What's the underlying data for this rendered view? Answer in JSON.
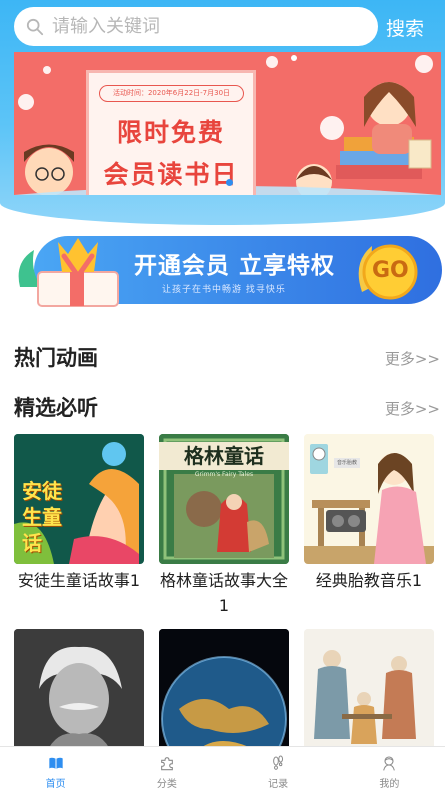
{
  "search": {
    "placeholder": "请输入关键词",
    "button_label": "搜索"
  },
  "banner": {
    "date_text": "活动时间：2020年6月22日-7月30日",
    "headline_line1": "限时免费",
    "headline_line2": "会员读书日"
  },
  "vip": {
    "title": "开通会员  立享特权",
    "subtitle": "让孩子在书中畅游  找寻快乐",
    "go_label": "GO"
  },
  "sections": [
    {
      "title": "热门动画",
      "more": "更多>>"
    },
    {
      "title": "精选必听",
      "more": "更多>>"
    }
  ],
  "books": [
    {
      "title": "安徒生童话故事1",
      "cover_text": "安徒生童话"
    },
    {
      "title": "格林童话故事大全1",
      "cover_text": "格林童话",
      "cover_subtext": "Grimm's Fairy Tales"
    },
    {
      "title": "经典胎教音乐1",
      "cover_text": "音乐胎教"
    },
    {
      "title": "",
      "cover_text": ""
    },
    {
      "title": "",
      "cover_text": ""
    },
    {
      "title": "",
      "cover_text": ""
    }
  ],
  "tabs": [
    {
      "label": "首页",
      "icon": "book-icon",
      "active": true
    },
    {
      "label": "分类",
      "icon": "puzzle-icon",
      "active": false
    },
    {
      "label": "记录",
      "icon": "footprint-icon",
      "active": false
    },
    {
      "label": "我的",
      "icon": "user-icon",
      "active": false
    }
  ],
  "colors": {
    "accent": "#2e8ef0",
    "header": "#3db6f5",
    "banner": "#f36d68"
  }
}
